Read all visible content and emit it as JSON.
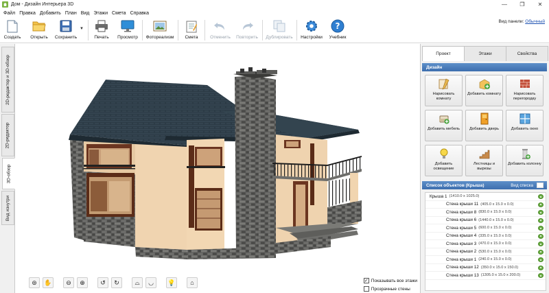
{
  "window": {
    "title": "Дом - Дизайн Интерьера 3D"
  },
  "menu": [
    "Файл",
    "Правка",
    "Добавить",
    "План",
    "Вид",
    "Этажи",
    "Смета",
    "Справка"
  ],
  "toolbar": {
    "create": "Создать",
    "open": "Открыть",
    "save": "Сохранить",
    "print": "Печать",
    "preview": "Просмотр",
    "photo": "Фотореализм",
    "estimate": "Смета",
    "undo": "Отменить",
    "redo": "Повторить",
    "duplicate": "Дублировать",
    "settings": "Настройки",
    "tutorial": "Учебник",
    "panel_view_label": "Вид панели:",
    "panel_view_value": "Обычный"
  },
  "left_tabs": [
    "2D-редактор и 3D-обзор",
    "2D-редактор",
    "3D-обзор",
    "Вид изнутри"
  ],
  "active_left_tab": "3D-обзор",
  "viewport": {
    "checkboxes": [
      {
        "label": "Показывать все этажи",
        "checked": true
      },
      {
        "label": "Прозрачные стены",
        "checked": false
      }
    ]
  },
  "right_panel": {
    "tabs": [
      "Проект",
      "Этажи",
      "Свойства"
    ],
    "active_tab": "Проект",
    "design_header": "Дизайн",
    "design_buttons": [
      {
        "label": "Нарисовать комнату",
        "icon": "draw-room-icon"
      },
      {
        "label": "Добавить комнату",
        "icon": "add-room-icon"
      },
      {
        "label": "Нарисовать перегородку",
        "icon": "draw-partition-icon"
      },
      {
        "label": "Добавить мебель",
        "icon": "furniture-icon"
      },
      {
        "label": "Добавить дверь",
        "icon": "door-icon"
      },
      {
        "label": "Добавить окно",
        "icon": "window-icon"
      },
      {
        "label": "Добавить освещение",
        "icon": "lamp-icon"
      },
      {
        "label": "Лестницы и вырезы",
        "icon": "stairs-icon"
      },
      {
        "label": "Добавить колонну",
        "icon": "column-icon"
      }
    ],
    "objects_header": "Список объектов (Крыша)",
    "objects_view_link": "Вид списка",
    "objects": [
      {
        "name": "Крыша 1",
        "dims": "(1410.0 x 1025.0)",
        "root": true
      },
      {
        "name": "Стена крыши 11",
        "dims": "(405.0 x 15.0 x 0.0)"
      },
      {
        "name": "Стена крыши 8",
        "dims": "(830.0 x 15.0 x 0.0)"
      },
      {
        "name": "Стена крыши 6",
        "dims": "(1440.0 x 15.0 x 0.0)"
      },
      {
        "name": "Стена крыши 5",
        "dims": "(600.0 x 15.0 x 0.0)"
      },
      {
        "name": "Стена крыши 4",
        "dims": "(335.0 x 15.0 x 0.0)"
      },
      {
        "name": "Стена крыши 3",
        "dims": "(470.0 x 15.0 x 0.0)"
      },
      {
        "name": "Стена крыши 2",
        "dims": "(530.0 x 15.0 x 0.0)"
      },
      {
        "name": "Стена крыши 1",
        "dims": "(240.0 x 15.0 x 0.0)"
      },
      {
        "name": "Стена крыши 12",
        "dims": "(350.0 x 15.0 x 150.0)"
      },
      {
        "name": "Стена крыши 13",
        "dims": "(1305.0 x 15.0 x 200.0)"
      }
    ]
  },
  "colors": {
    "section_header": "#4a7cbd",
    "roof": "#2b3a45",
    "stone": "#5a5a58",
    "plaster": "#eed2ad",
    "wood": "#7a3a22"
  }
}
